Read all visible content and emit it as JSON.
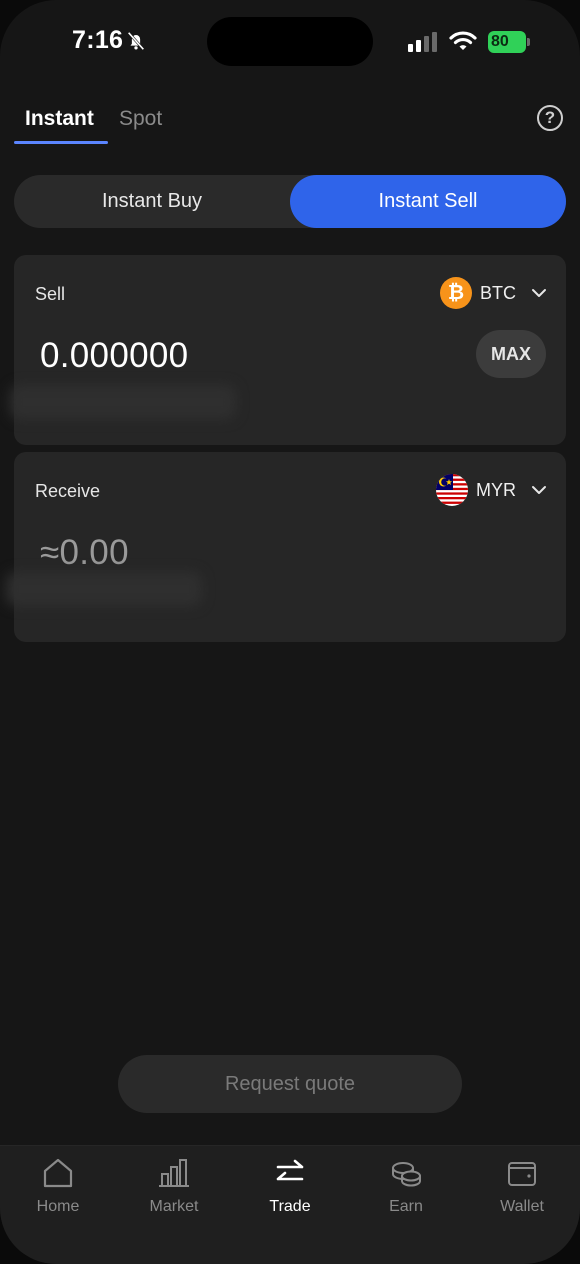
{
  "status_bar": {
    "time": "7:16",
    "battery": "80"
  },
  "tabs": [
    {
      "label": "Instant",
      "active": true
    },
    {
      "label": "Spot",
      "active": false
    }
  ],
  "mode": {
    "buy_label": "Instant Buy",
    "sell_label": "Instant Sell",
    "selected": "Instant Sell"
  },
  "sell_card": {
    "label": "Sell",
    "currency": "BTC",
    "amount": "0.000000",
    "max_label": "MAX"
  },
  "receive_card": {
    "label": "Receive",
    "currency": "MYR",
    "amount": "≈0.00"
  },
  "request_quote_label": "Request quote",
  "nav": [
    {
      "label": "Home",
      "icon": "home-icon"
    },
    {
      "label": "Market",
      "icon": "market-icon"
    },
    {
      "label": "Trade",
      "icon": "trade-icon",
      "active": true
    },
    {
      "label": "Earn",
      "icon": "earn-icon"
    },
    {
      "label": "Wallet",
      "icon": "wallet-icon"
    }
  ],
  "colors": {
    "accent": "#2f64ea",
    "background": "#161616",
    "card": "#262626",
    "btc": "#f7931a",
    "battery": "#30d158"
  }
}
